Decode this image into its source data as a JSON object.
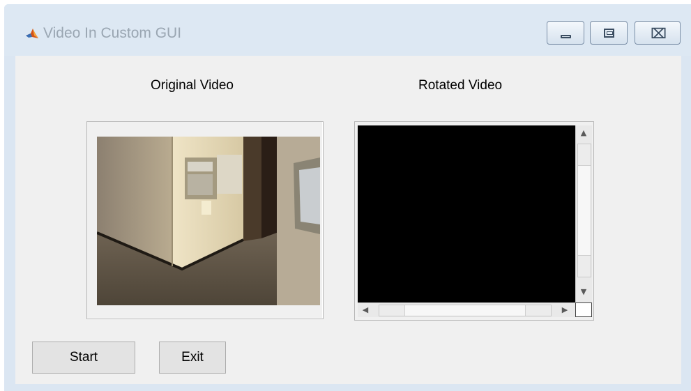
{
  "window": {
    "title": "Video In Custom GUI",
    "controls": [
      "minimize",
      "maximize",
      "close"
    ],
    "close_glyph": "⌧"
  },
  "panels": {
    "original": {
      "label": "Original Video"
    },
    "rotated": {
      "label": "Rotated Video"
    }
  },
  "buttons": {
    "start_label": "Start",
    "exit_label": "Exit"
  },
  "scrollbar_glyphs": {
    "up": "▲",
    "down": "▼",
    "left": "◀",
    "right": "▶"
  },
  "colors": {
    "titlebar": "#dde8f3",
    "client_bg": "#f0f0f0",
    "rotated_video_bg": "#000000",
    "title_text": "#9aa6b2"
  },
  "icons": [
    "matlab-icon",
    "minimize-icon",
    "maximize-icon",
    "close-icon"
  ]
}
